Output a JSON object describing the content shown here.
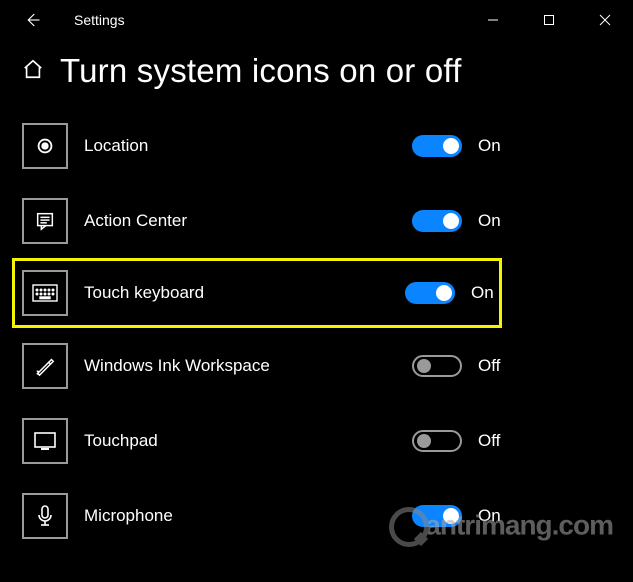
{
  "window": {
    "title": "Settings"
  },
  "page": {
    "heading": "Turn system icons on or off"
  },
  "states": {
    "on": "On",
    "off": "Off"
  },
  "items": [
    {
      "key": "location",
      "label": "Location",
      "on": true,
      "highlighted": false
    },
    {
      "key": "action-center",
      "label": "Action Center",
      "on": true,
      "highlighted": false
    },
    {
      "key": "touch-keyboard",
      "label": "Touch keyboard",
      "on": true,
      "highlighted": true
    },
    {
      "key": "ink-workspace",
      "label": "Windows Ink Workspace",
      "on": false,
      "highlighted": false
    },
    {
      "key": "touchpad",
      "label": "Touchpad",
      "on": false,
      "highlighted": false
    },
    {
      "key": "microphone",
      "label": "Microphone",
      "on": true,
      "highlighted": false
    }
  ],
  "watermark": "antrimang.com"
}
